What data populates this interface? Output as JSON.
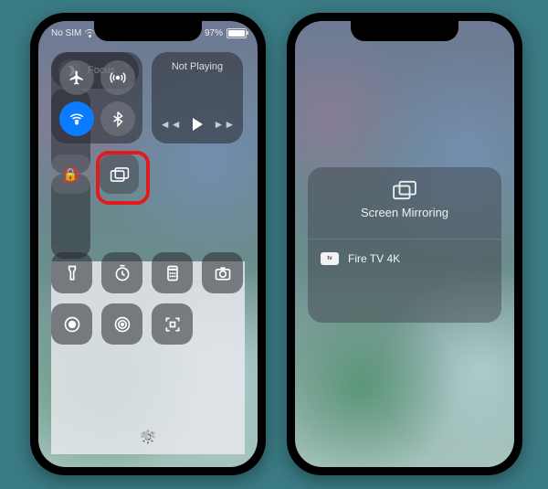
{
  "status": {
    "carrier": "No SIM",
    "battery": "97%",
    "location_glyph": "➤"
  },
  "cc": {
    "media_title": "Not Playing",
    "focus_label": "Focus",
    "brightness_pct": 48,
    "highlight_target": "screen-mirroring-tile"
  },
  "mirroring": {
    "title": "Screen Mirroring",
    "device_badge": "tv",
    "device_name": "Fire TV 4K"
  }
}
